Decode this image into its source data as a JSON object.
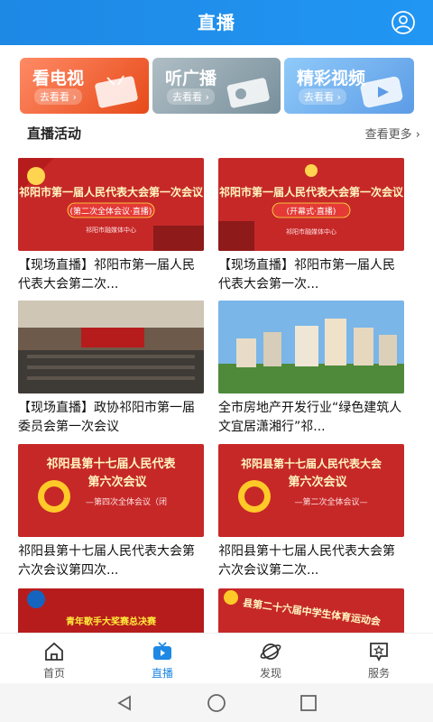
{
  "header": {
    "title": "直播"
  },
  "quick_links": [
    {
      "label": "看电视",
      "sub": "去看看 ›"
    },
    {
      "label": "听广播",
      "sub": "去看看 ›"
    },
    {
      "label": "精彩视频",
      "sub": "去看看 ›"
    }
  ],
  "section": {
    "title": "直播活动",
    "more": "查看更多 ›"
  },
  "cards": [
    {
      "title": "【现场直播】祁阳市第一届人民代表大会第二次...",
      "banner": "祁阳市第一届人民代表大会第一次会议",
      "subbanner": "(第二次全体会议·直播)",
      "footer": "祁阳市融媒体中心"
    },
    {
      "title": "【现场直播】祁阳市第一届人民代表大会第一次...",
      "banner": "祁阳市第一届人民代表大会第一次会议",
      "subbanner": "(开幕式·直播)",
      "footer": "祁阳市融媒体中心"
    },
    {
      "title": "【现场直播】政协祁阳市第一届委员会第一次会议"
    },
    {
      "title": "全市房地产开发行业“绿色建筑人文宜居潇湘行”祁..."
    },
    {
      "title": "祁阳县第十七届人民代表大会第六次会议第四次...",
      "banner": "祁阳县第十七届人民代表",
      "subbanner": "第六次会议",
      "tag": "—第四次全体会议（闭"
    },
    {
      "title": "祁阳县第十七届人民代表大会第六次会议第二次...",
      "banner": "祁阳县第十七届人民代表大会",
      "subbanner": "第六次会议",
      "tag": "—第二次全体会议—"
    },
    {
      "title": "",
      "banner": "青年歌手大奖赛总决赛"
    },
    {
      "title": "",
      "banner": "县第二十六届中学生体育运动会"
    }
  ],
  "tabs": [
    {
      "label": "首页",
      "icon": "home-icon"
    },
    {
      "label": "直播",
      "icon": "tv-icon"
    },
    {
      "label": "发现",
      "icon": "planet-icon"
    },
    {
      "label": "服务",
      "icon": "star-box-icon"
    }
  ],
  "colors": {
    "primary": "#1e88e5",
    "banner_red": "#c62828"
  }
}
